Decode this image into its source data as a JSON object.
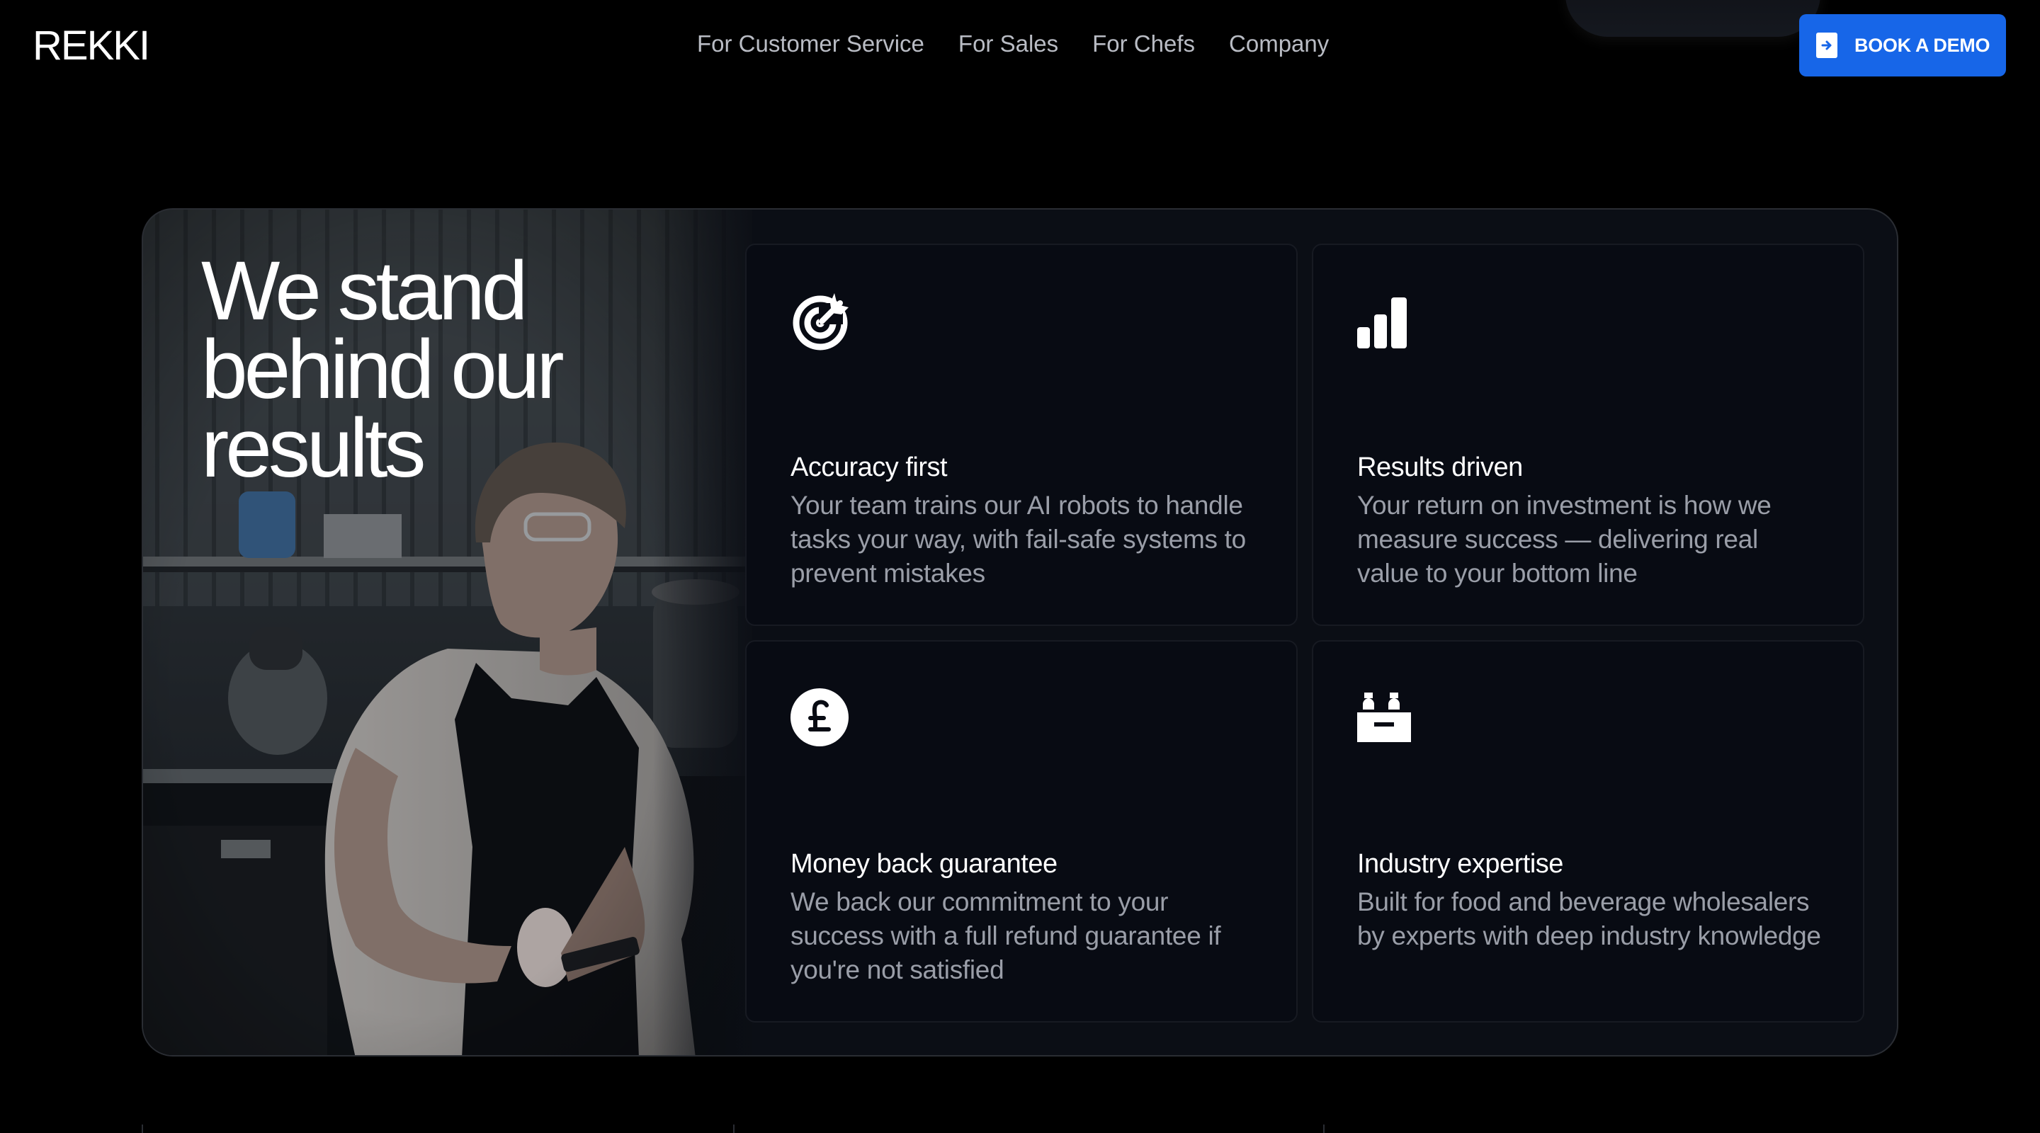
{
  "brand": {
    "logo": "REKKI"
  },
  "nav": {
    "items": [
      {
        "label": "For Customer Service"
      },
      {
        "label": "For Sales"
      },
      {
        "label": "For Chefs"
      },
      {
        "label": "Company"
      }
    ]
  },
  "cta": {
    "label": "BOOK A DEMO",
    "color": "#1766e8"
  },
  "hero": {
    "headline": "We stand behind our results"
  },
  "features": [
    {
      "icon": "target-arrow-icon",
      "title": "Accuracy first",
      "description": "Your team trains our AI robots to handle tasks your way, with fail-safe systems to prevent mistakes"
    },
    {
      "icon": "bar-chart-icon",
      "title": "Results driven",
      "description": "Your return on investment is how we measure success — delivering real value to your bottom line"
    },
    {
      "icon": "pound-coin-icon",
      "title": "Money back guarantee",
      "description": "We back our commitment to your success with a full refund guarantee if you're not satisfied"
    },
    {
      "icon": "warehouse-bottles-icon",
      "title": "Industry expertise",
      "description": "Built for food and beverage wholesalers by experts with deep industry knowledge"
    }
  ]
}
